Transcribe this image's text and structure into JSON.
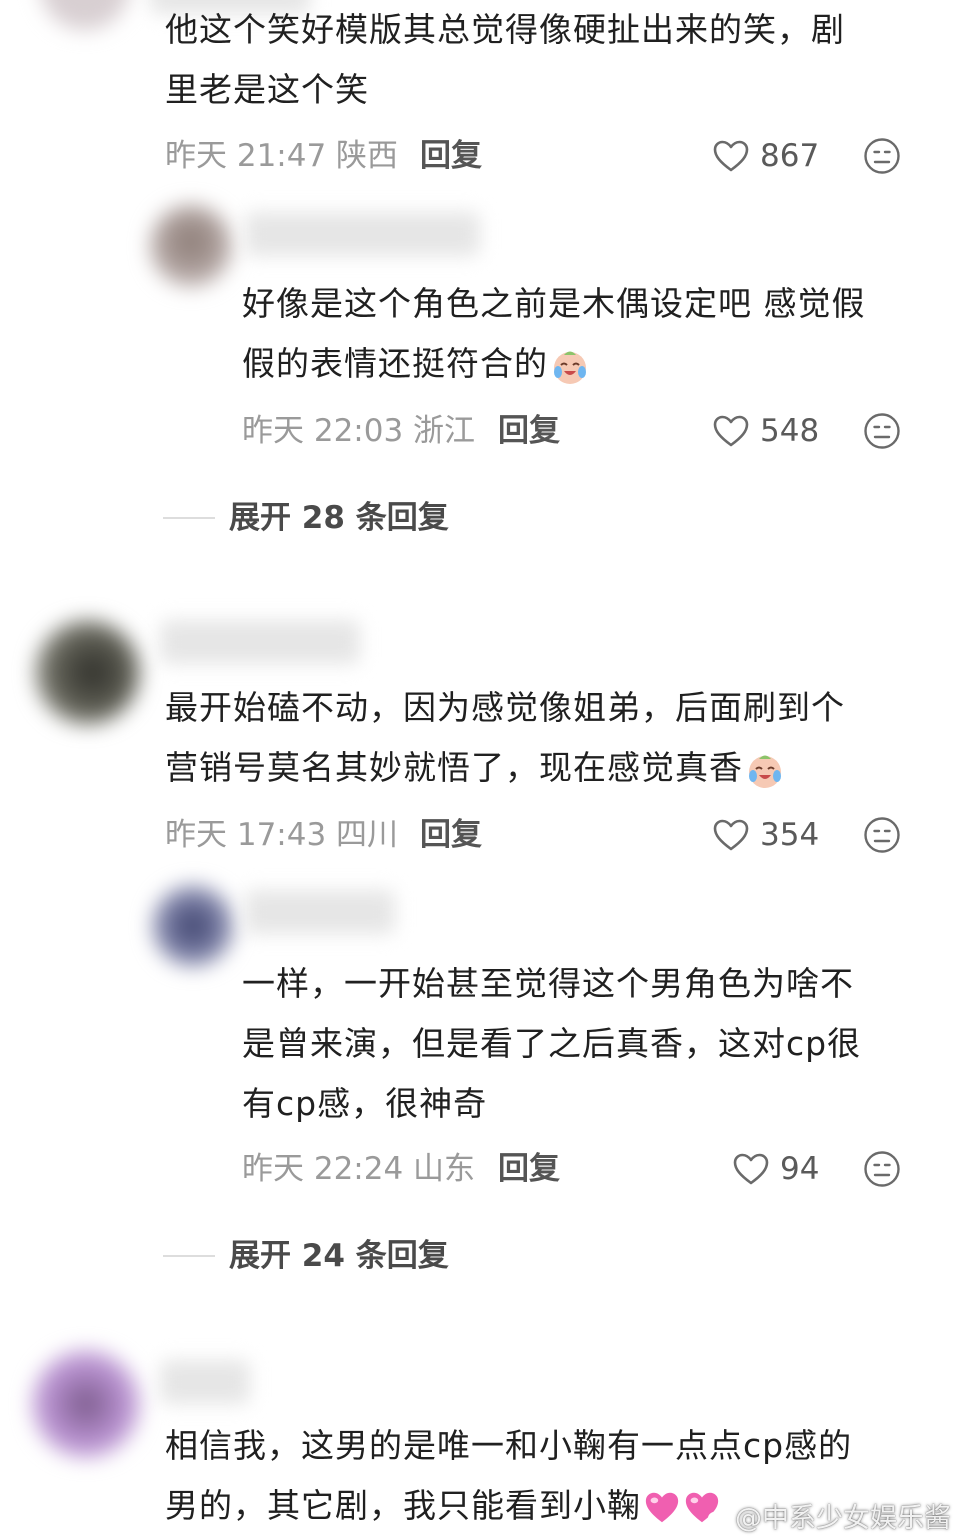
{
  "comments": [
    {
      "text_lines": [
        "他这个笑好模版其总觉得像硬扯出来的笑，剧",
        "里老是这个笑"
      ],
      "meta": "昨天 21:47 陕西",
      "reply_label": "回复",
      "likes": "867"
    },
    {
      "text_lines": [
        "好像是这个角色之前是木偶设定吧 感觉假",
        "假的表情还挺符合的"
      ],
      "meta": "昨天 22:03 浙江",
      "reply_label": "回复",
      "likes": "548"
    },
    {
      "text_lines": [
        "最开始磕不动，因为感觉像姐弟，后面刷到个",
        "营销号莫名其妙就悟了，现在感觉真香"
      ],
      "meta": "昨天 17:43 四川",
      "reply_label": "回复",
      "likes": "354"
    },
    {
      "text_lines": [
        "一样，一开始甚至觉得这个男角色为啥不",
        "是曾来演，但是看了之后真香，这对cp很",
        "有cp感，很神奇"
      ],
      "meta": "昨天 22:24 山东",
      "reply_label": "回复",
      "likes": "94"
    },
    {
      "text_lines": [
        "相信我，这男的是唯一和小鞠有一点点cp感的",
        "男的，其它剧，我只能看到小鞠"
      ]
    }
  ],
  "expand_1": "展开 28 条回复",
  "expand_2": "展开 24 条回复",
  "watermark": "@中系少女娱乐酱",
  "icons": {
    "like": "heart-outline-icon",
    "dislike": "neutral-face-icon",
    "emoji": "crying-laughing-face-emoji",
    "heart": "pink-heart-emoji"
  },
  "colors": {
    "meta": "#9a9a9a",
    "text": "#202020",
    "accent_pink": "#f05fb0"
  }
}
